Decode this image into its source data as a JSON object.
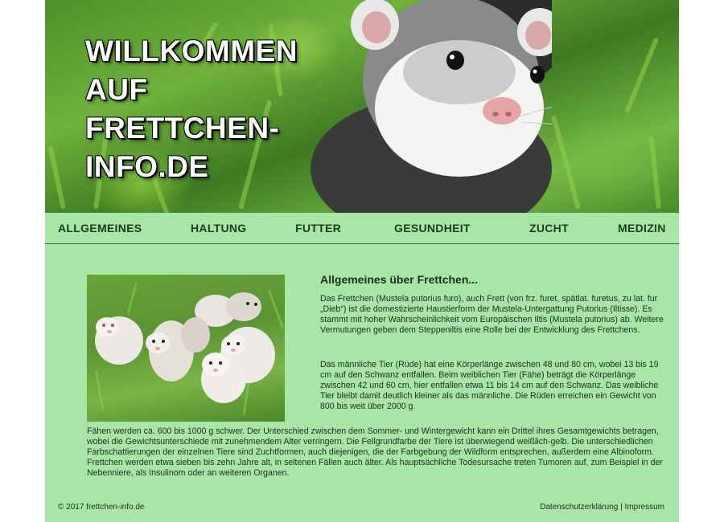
{
  "hero": {
    "title_lines": [
      "WILLKOMMEN",
      "AUF",
      "FRETTCHEN-",
      "INFO.DE"
    ]
  },
  "nav": {
    "items": [
      {
        "label": "ALLGEMEINES"
      },
      {
        "label": "HALTUNG"
      },
      {
        "label": "FUTTER"
      },
      {
        "label": "GESUNDHEIT"
      },
      {
        "label": "ZUCHT"
      },
      {
        "label": "MEDIZIN"
      }
    ]
  },
  "content": {
    "heading": "Allgemeines über Frettchen...",
    "paragraph_1": "Das Frettchen (Mustela putorius furo), auch Frett (von frz. furet, spätlat. furetus, zu lat. fur „Dieb“) ist die domestizierte Haustierform der Mustela-Untergattung Putorius (Iltisse). Es stammt mit hoher Wahrscheinlichkeit vom Europäischen Iltis (Mustela putorius) ab. Weitere Vermutungen geben dem Steppeniltis eine Rolle bei der Entwicklung des Frettchens.",
    "paragraph_2": "Das männliche Tier (Rüde) hat eine Körperlänge zwischen 48 und 80 cm, wobei 13 bis 19 cm auf den Schwanz entfallen. Beim weiblichen Tier (Fähe) beträgt die Körperlänge zwischen 42 und 60 cm, hier entfallen etwa 11 bis 14 cm auf den Schwanz. Das weibliche Tier bleibt damit deutlich kleiner als das männliche. Die Rüden erreichen ein Gewicht von 800 bis weit über 2000 g.",
    "paragraph_3": "Fähen werden ca. 600 bis 1000 g schwer. Der Unterschied zwischen dem Sommer- und Wintergewicht kann ein Drittel ihres Gesamtgewichts betragen, wobei die Gewichtsunterschiede mit zunehmendem Alter verringern. Die Fellgrundfarbe der Tiere ist überwiegend weißlich-gelb. Die unterschiedlichen Farbschattierungen der einzelnen Tiere sind Zuchtformen, auch diejenigen, die der Farbgebung der Wildform entsprechen, außerdem eine Albinoform. Frettchen werden etwa sieben bis zehn Jahre alt, in seltenen Fällen auch älter. Als hauptsächliche Todesursache treten Tumoren auf, zum Beispiel in der Nebenniere, als Insulinom oder an weiteren Organen."
  },
  "footer": {
    "copyright": "© 2017 frettchen-info.de",
    "privacy": "Datenschutzerklärung",
    "separator": "|",
    "imprint": "Impressum"
  },
  "colors": {
    "page_background": "#a8e6a8",
    "nav_text": "#1c3c1c",
    "divider": "#2f6f2f"
  }
}
